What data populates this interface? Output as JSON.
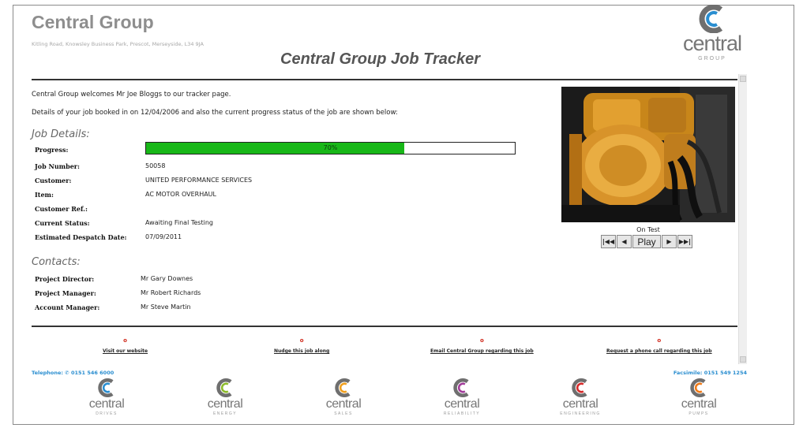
{
  "header": {
    "company_name": "Central Group",
    "address": "Kitling Road, Knowsley Business Park, Prescot, Merseyside, L34 9JA",
    "title": "Central Group Job Tracker",
    "logo": {
      "word": "central",
      "sub": "GROUP",
      "icon": "central-c-logo-icon",
      "color": "#2a8ed0"
    }
  },
  "intro": {
    "welcome": "Central Group welcomes Mr Joe Bloggs to our tracker page.",
    "details": "Details of your job booked in on 12/04/2006 and also the current progress status of the job are shown below:"
  },
  "job": {
    "heading": "Job Details:",
    "progress_label": "Progress:",
    "progress_text": "70%",
    "progress_value": 0.7,
    "progress_color": "#18b718",
    "fields": [
      {
        "label": "Job Number:",
        "value": "50058"
      },
      {
        "label": "Customer:",
        "value": "UNITED PERFORMANCE SERVICES"
      },
      {
        "label": "Item:",
        "value": "AC MOTOR OVERHAUL"
      },
      {
        "label": "Customer Ref.:",
        "value": ""
      },
      {
        "label": "Current Status:",
        "value": "Awaiting Final Testing"
      },
      {
        "label": "Estimated Despatch Date:",
        "value": "07/09/2011"
      }
    ]
  },
  "contacts": {
    "heading": "Contacts:",
    "items": [
      {
        "label": "Project Director:",
        "value": "Mr Gary Downes"
      },
      {
        "label": "Project Manager:",
        "value": "Mr Robert Richards"
      },
      {
        "label": "Account Manager:",
        "value": "Mr Steve Martin"
      }
    ]
  },
  "slideshow": {
    "caption": "On Test",
    "first_icon": "skip-first-icon",
    "prev_icon": "step-back-icon",
    "play_label": "Play",
    "next_icon": "step-forward-icon",
    "last_icon": "skip-last-icon"
  },
  "actions": [
    {
      "label": "Visit our website",
      "marker": "o"
    },
    {
      "label": "Nudge this job along",
      "marker": "o"
    },
    {
      "label": "Email Central Group regarding this job",
      "marker": "o"
    },
    {
      "label": "Request a phone call regarding this job",
      "marker": "o"
    }
  ],
  "footer": {
    "telephone": "Telephone: ✆ 0151 546 6000",
    "facsimile": "Facsimile: 0151 549 1254",
    "divisions": [
      {
        "word": "central",
        "sub": "DRIVES",
        "color": "#2a8ed0"
      },
      {
        "word": "central",
        "sub": "ENERGY",
        "color": "#8dbb2b"
      },
      {
        "word": "central",
        "sub": "SALES",
        "color": "#f0a020"
      },
      {
        "word": "central",
        "sub": "RELIABILITY",
        "color": "#a23c9a"
      },
      {
        "word": "central",
        "sub": "ENGINEERING",
        "color": "#d62a2a"
      },
      {
        "word": "central",
        "sub": "PUMPS",
        "color": "#f07a18"
      }
    ]
  }
}
